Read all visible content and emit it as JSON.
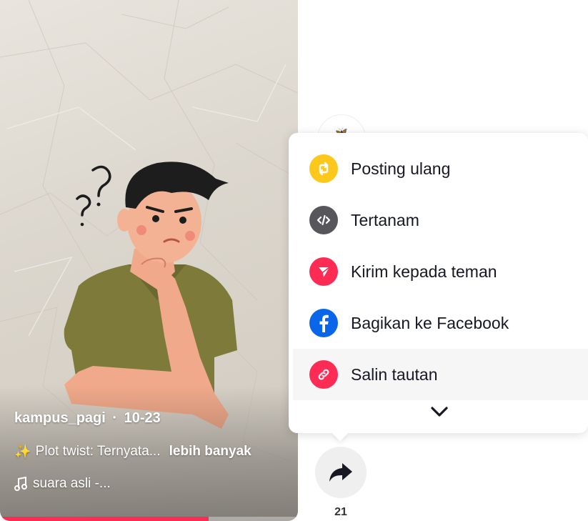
{
  "video": {
    "author": "kampus_pagi",
    "date": "10-23",
    "separator": "·",
    "description_emoji": "✨",
    "description": "Plot twist: Ternyata...",
    "more_label": "lebih banyak",
    "music_icon": "music-note-icon",
    "music": "suara asli -...",
    "progress": 0.7,
    "accent": "#fe2c55"
  },
  "share": {
    "count": "21",
    "icon": "share-arrow-icon"
  },
  "share_menu": {
    "items": [
      {
        "label": "Posting ulang",
        "icon": "repost-icon",
        "color": "#fcc81c"
      },
      {
        "label": "Tertanam",
        "icon": "embed-code-icon",
        "color": "#56565b"
      },
      {
        "label": "Kirim kepada teman",
        "icon": "send-paper-plane-icon",
        "color": "#fe2c55"
      },
      {
        "label": "Bagikan ke Facebook",
        "icon": "facebook-icon",
        "color": "#0a66e8"
      },
      {
        "label": "Salin tautan",
        "icon": "link-icon",
        "color": "#fe2c55"
      }
    ],
    "expand_icon": "chevron-down-icon"
  }
}
